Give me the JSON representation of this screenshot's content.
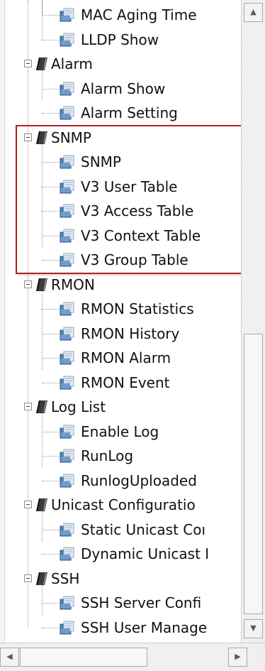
{
  "tree": {
    "items": [
      {
        "label": "MAC Aging Time",
        "kind": "leaf"
      },
      {
        "label": "LLDP Show",
        "kind": "leaf"
      },
      {
        "label": "Alarm",
        "kind": "folder",
        "expanded": true
      },
      {
        "label": "Alarm Show",
        "kind": "leaf"
      },
      {
        "label": "Alarm Setting",
        "kind": "leaf"
      },
      {
        "label": "SNMP",
        "kind": "folder",
        "expanded": true
      },
      {
        "label": "SNMP",
        "kind": "leaf"
      },
      {
        "label": "V3 User Table",
        "kind": "leaf"
      },
      {
        "label": "V3 Access Table",
        "kind": "leaf"
      },
      {
        "label": "V3 Context Table",
        "kind": "leaf"
      },
      {
        "label": "V3 Group Table",
        "kind": "leaf"
      },
      {
        "label": "RMON",
        "kind": "folder",
        "expanded": true
      },
      {
        "label": "RMON Statistics",
        "kind": "leaf"
      },
      {
        "label": "RMON History",
        "kind": "leaf"
      },
      {
        "label": "RMON Alarm",
        "kind": "leaf"
      },
      {
        "label": "RMON Event",
        "kind": "leaf"
      },
      {
        "label": "Log List",
        "kind": "folder",
        "expanded": true
      },
      {
        "label": "Enable Log",
        "kind": "leaf"
      },
      {
        "label": "RunLog",
        "kind": "leaf"
      },
      {
        "label": "RunlogUploaded",
        "kind": "leaf"
      },
      {
        "label": "Unicast Configuratio",
        "kind": "folder",
        "expanded": true
      },
      {
        "label": "Static Unicast Coı",
        "kind": "leaf"
      },
      {
        "label": "Dynamic Unicast I",
        "kind": "leaf"
      },
      {
        "label": "SSH",
        "kind": "folder",
        "expanded": true
      },
      {
        "label": "SSH Server Confi",
        "kind": "leaf"
      },
      {
        "label": "SSH User Manage",
        "kind": "leaf"
      }
    ]
  },
  "highlight": {
    "group": "SNMP",
    "color": "#b51e22"
  },
  "icons": {
    "folder": "book-icon",
    "leaf": "page-icon",
    "expander": "collapse-minus-icon"
  },
  "scroll": {
    "up": "▲",
    "down": "▼",
    "left": "◀",
    "right": "▶"
  }
}
